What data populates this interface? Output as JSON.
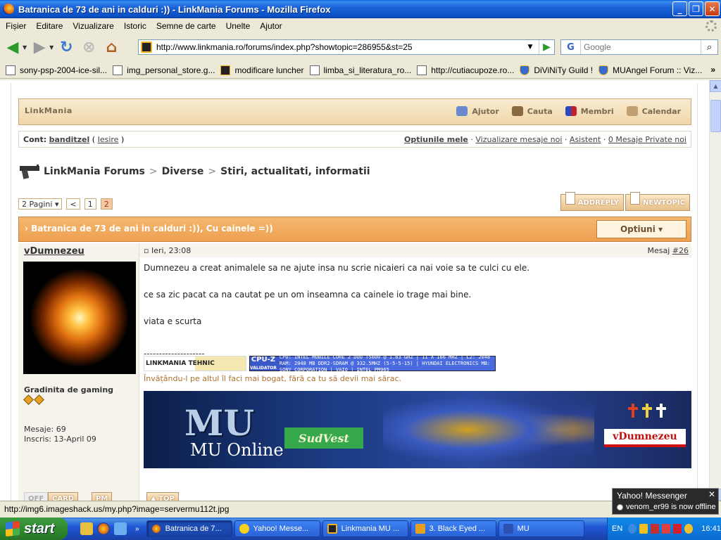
{
  "window": {
    "title": "Batranica de 73 de ani in calduri :)) - LinkMania Forums - Mozilla Firefox",
    "min_label": "_",
    "max_label": "❐",
    "close_label": "✕"
  },
  "menu": [
    "Fișier",
    "Editare",
    "Vizualizare",
    "Istoric",
    "Semne de carte",
    "Unelte",
    "Ajutor"
  ],
  "nav": {
    "url": "http://www.linkmania.ro/forums/index.php?showtopic=286955&st=25",
    "search_placeholder": "Google",
    "search_engine": "G"
  },
  "bookmarks": [
    "sony-psp-2004-ice-sil...",
    "img_personal_store.g...",
    "modificare luncher",
    "limba_si_literatura_ro...",
    "http://cutiacupoze.ro...",
    "DiViNiTy Guild !",
    "MUAngel Forum :: Viz..."
  ],
  "bookmarks_more": "»",
  "forum": {
    "brand": "LinkMania",
    "toplinks": [
      "Ajutor",
      "Cauta",
      "Membri",
      "Calendar"
    ],
    "account_label": "Cont:",
    "username": "banditzel",
    "logout": "Iesire",
    "userlinks": {
      "my_options": "Optiunile mele",
      "new_posts": "Vizualizare mesaje noi",
      "assistant": "Asistent",
      "pms": "0 Mesaje Private noi"
    },
    "breadcrumb": [
      "LinkMania Forums",
      "Diverse",
      "Stiri, actualitati, informatii"
    ],
    "breadcrumb_sep": ">",
    "pager": {
      "pages": "2 Pagini ▾",
      "prev": "<",
      "p1": "1",
      "p2": "2"
    },
    "buttons": {
      "add_reply": "ADDREPLY",
      "new_topic": "NEWTOPIC"
    },
    "topic_title": "› Batranica de 73 de ani in calduri :)), Cu cainele =))",
    "options": "Optiuni ▾"
  },
  "post": {
    "author": "vDumnezeu",
    "rank": "Gradinita de gaming",
    "posts": "Mesaje: 69",
    "joined": "Inscris: 13-April 09",
    "date": "Ieri, 23:08",
    "number_label": "Mesaj",
    "number": "#26",
    "body": [
      "Dumnezeu a creat animalele sa ne ajute insa nu scrie nicaieri ca nai voie sa te culci cu ele.",
      "ce sa zic pacat ca na cautat pe un om inseamna ca cainele io trage mai bine.",
      "viata e scurta"
    ],
    "sig_line": "--------------------",
    "badge_left": "LINKMANIA TEHNIC",
    "badge_cpuz": "CPU-Z",
    "badge_cpuz_sub": "VALIDATOR",
    "badge_cpu_text": "CPU: INTEL MOBILE CORE 2 DUO T5600 @ 1.83 GHZ | 11 X 166 MHZ | L2: 2048 RAM: 2048 MB DDR2-SDRAM @ 332.5MHZ (5-5-5-15) | HYUNDAI ELECTRONICS MB: SONY CORPORATION | VAIO | INTEL PM965",
    "quote": "Învățându-l pe altul îl faci mai bogat, fără ca tu să devii mai sărac.",
    "banner": {
      "mu": "MU",
      "online": "MU Online",
      "server": "SudVest",
      "nick": "vDumnezeu"
    },
    "foot": {
      "off": "OFF",
      "card": "CARD",
      "pm": "PM",
      "top": "▲ TOP"
    }
  },
  "status_text": "http://img6.imageshack.us/my.php?image=servermu112t.jpg",
  "yahoo": {
    "title": "Yahoo! Messenger",
    "close": "✕",
    "message": "venom_er99 is now offline"
  },
  "taskbar": {
    "start": "start",
    "tasks": [
      "Batranica de 7...",
      "Yahoo! Messe...",
      "Linkmania MU ...",
      "3. Black Eyed ...",
      "MU"
    ],
    "lang": "EN",
    "clock": "16:41",
    "more": "»"
  }
}
